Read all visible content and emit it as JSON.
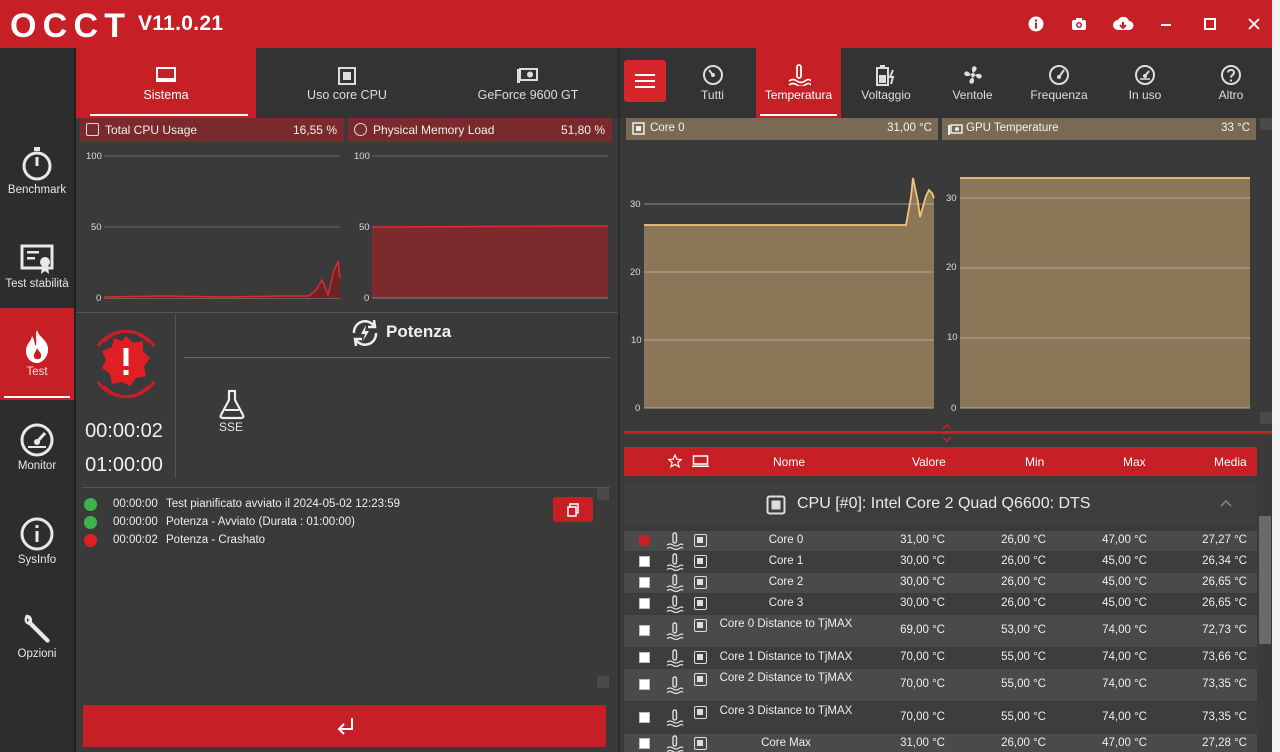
{
  "app": {
    "logo_text": "OCCT",
    "version": "V11.0.21"
  },
  "sidebar": {
    "items": [
      {
        "label": "Benchmark",
        "icon": "stopwatch-icon"
      },
      {
        "label": "Test stabilità",
        "icon": "certificate-icon"
      },
      {
        "label": "Test",
        "icon": "flame-icon",
        "active": true
      },
      {
        "label": "Monitor",
        "icon": "gauge-icon"
      },
      {
        "label": "SysInfo",
        "icon": "info-icon"
      },
      {
        "label": "Opzioni",
        "icon": "wrench-icon"
      }
    ]
  },
  "left_tabs": [
    {
      "label": "Sistema",
      "icon": "monitor-icon",
      "active": true
    },
    {
      "label": "Uso core CPU",
      "icon": "cpu-icon"
    },
    {
      "label": "GeForce 9600 GT",
      "icon": "gpu-icon"
    }
  ],
  "cpu_usage": {
    "title": "Total CPU Usage",
    "value": "16,55 %",
    "y_ticks": [
      "100",
      "50",
      "0"
    ]
  },
  "memory_load": {
    "title": "Physical Memory Load",
    "value": "51,80 %",
    "y_ticks": [
      "100",
      "50",
      "0"
    ]
  },
  "test": {
    "status": "error",
    "elapsed": "00:00:02",
    "duration": "01:00:00",
    "name": "Potenza",
    "instruction_set": "SSE"
  },
  "log": [
    {
      "time": "00:00:00",
      "message": "Test pianificato avviato il 2024-05-02 12:23:59",
      "status": "ok"
    },
    {
      "time": "00:00:00",
      "message": "Potenza - Avviato (Durata : 01:00:00)",
      "status": "ok"
    },
    {
      "time": "00:00:02",
      "message": "Potenza - Crashato",
      "status": "error"
    }
  ],
  "right_tabs": [
    {
      "label": "Tutti",
      "icon": "dashboard-icon"
    },
    {
      "label": "Temperatura",
      "icon": "thermometer-icon",
      "active": true
    },
    {
      "label": "Voltaggio",
      "icon": "battery-icon"
    },
    {
      "label": "Ventole",
      "icon": "fan-icon"
    },
    {
      "label": "Frequenza",
      "icon": "speedometer-icon"
    },
    {
      "label": "In uso",
      "icon": "gauge-icon"
    },
    {
      "label": "Altro",
      "icon": "question-icon"
    }
  ],
  "core0_chart": {
    "title": "Core 0",
    "value": "31,00 °C",
    "y_ticks": [
      "30",
      "20",
      "10",
      "0"
    ]
  },
  "gpu_chart": {
    "title": "GPU Temperature",
    "value": "33 °C",
    "y_ticks": [
      "30",
      "20",
      "10",
      "0"
    ]
  },
  "table": {
    "headers": {
      "name": "Nome",
      "value": "Valore",
      "min": "Min",
      "max": "Max",
      "avg": "Media"
    },
    "group": "CPU [#0]: Intel Core 2 Quad Q6600: DTS",
    "rows": [
      {
        "name": "Core 0",
        "value": "31,00 °C",
        "min": "26,00 °C",
        "max": "47,00 °C",
        "avg": "27,27 °C",
        "checked": true
      },
      {
        "name": "Core 1",
        "value": "30,00 °C",
        "min": "26,00 °C",
        "max": "45,00 °C",
        "avg": "26,34 °C",
        "checked": false
      },
      {
        "name": "Core 2",
        "value": "30,00 °C",
        "min": "26,00 °C",
        "max": "45,00 °C",
        "avg": "26,65 °C",
        "checked": false
      },
      {
        "name": "Core 3",
        "value": "30,00 °C",
        "min": "26,00 °C",
        "max": "45,00 °C",
        "avg": "26,65 °C",
        "checked": false
      },
      {
        "name": "Core 0 Distance to TjMAX",
        "value": "69,00 °C",
        "min": "53,00 °C",
        "max": "74,00 °C",
        "avg": "72,73 °C",
        "checked": false
      },
      {
        "name": "Core 1 Distance to TjMAX",
        "value": "70,00 °C",
        "min": "55,00 °C",
        "max": "74,00 °C",
        "avg": "73,66 °C",
        "checked": false
      },
      {
        "name": "Core 2 Distance to TjMAX",
        "value": "70,00 °C",
        "min": "55,00 °C",
        "max": "74,00 °C",
        "avg": "73,35 °C",
        "checked": false
      },
      {
        "name": "Core 3 Distance to TjMAX",
        "value": "70,00 °C",
        "min": "55,00 °C",
        "max": "74,00 °C",
        "avg": "73,35 °C",
        "checked": false
      },
      {
        "name": "Core Max",
        "value": "31,00 °C",
        "min": "26,00 °C",
        "max": "47,00 °C",
        "avg": "27,28 °C",
        "checked": false
      }
    ]
  },
  "colors": {
    "accent": "#c62026",
    "panel": "#3a3a3a",
    "sidebar": "#2d2d2d",
    "temp_fill": "#8b7758",
    "temp_line": "#f5c37a"
  }
}
